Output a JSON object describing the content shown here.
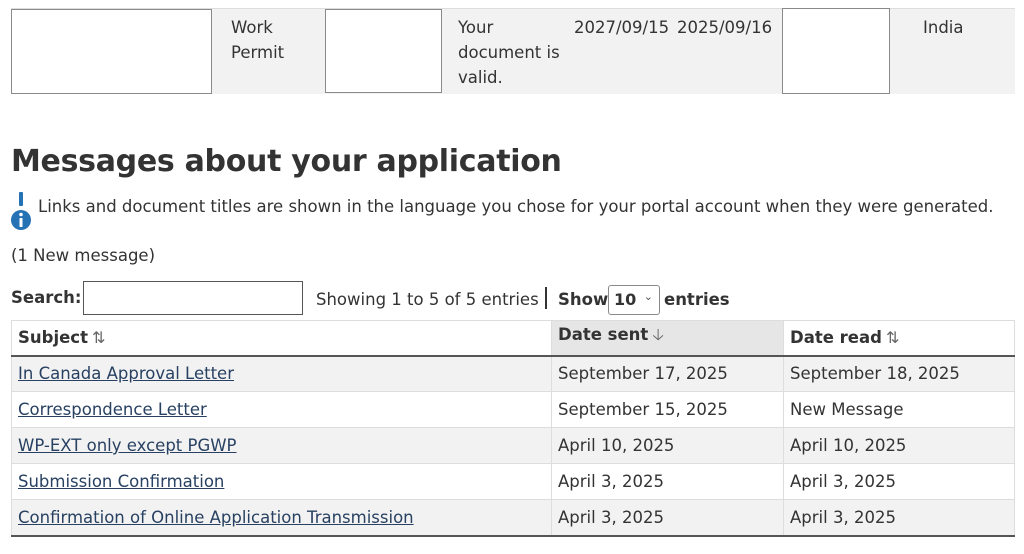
{
  "document_row": {
    "type": "Work Permit",
    "status": "Your document is valid.",
    "expiry_date": "2027/09/15",
    "issue_date": "2025/09/16",
    "country": "India"
  },
  "messages": {
    "heading": "Messages about your application",
    "info_text": "Links and document titles are shown in the language you chose for your portal account when they were generated.",
    "new_count_text": "(1 New message)",
    "search_label": "Search:",
    "search_value": "",
    "showing_text": "Showing 1 to 5 of 5 entries",
    "show_label": "Show",
    "page_size": "10",
    "entries_label": "entries",
    "columns": {
      "subject": "Subject",
      "date_sent": "Date sent",
      "date_read": "Date read"
    },
    "sorted_column": "date_sent",
    "sort_direction": "descending",
    "rows": [
      {
        "subject": "In Canada Approval Letter",
        "date_sent": "September 17, 2025",
        "date_read": "September 18, 2025"
      },
      {
        "subject": "Correspondence Letter",
        "date_sent": "September 15, 2025",
        "date_read": "New Message"
      },
      {
        "subject": "WP-EXT only except PGWP",
        "date_sent": "April 10, 2025",
        "date_read": "April 10, 2025"
      },
      {
        "subject": "Submission Confirmation",
        "date_sent": "April 3, 2025",
        "date_read": "April 3, 2025"
      },
      {
        "subject": "Confirmation of Online Application Transmission",
        "date_sent": "April 3, 2025",
        "date_read": "April 3, 2025"
      }
    ]
  },
  "icons": {
    "info": "info-icon",
    "sort_unsorted": "sort-both-icon",
    "sort_desc": "sort-down-arrow-icon",
    "select_chevron": "chevron-down-icon"
  },
  "colors": {
    "link": "#284162",
    "info_icon": "#2572b4",
    "stripe": "#f2f2f2"
  }
}
